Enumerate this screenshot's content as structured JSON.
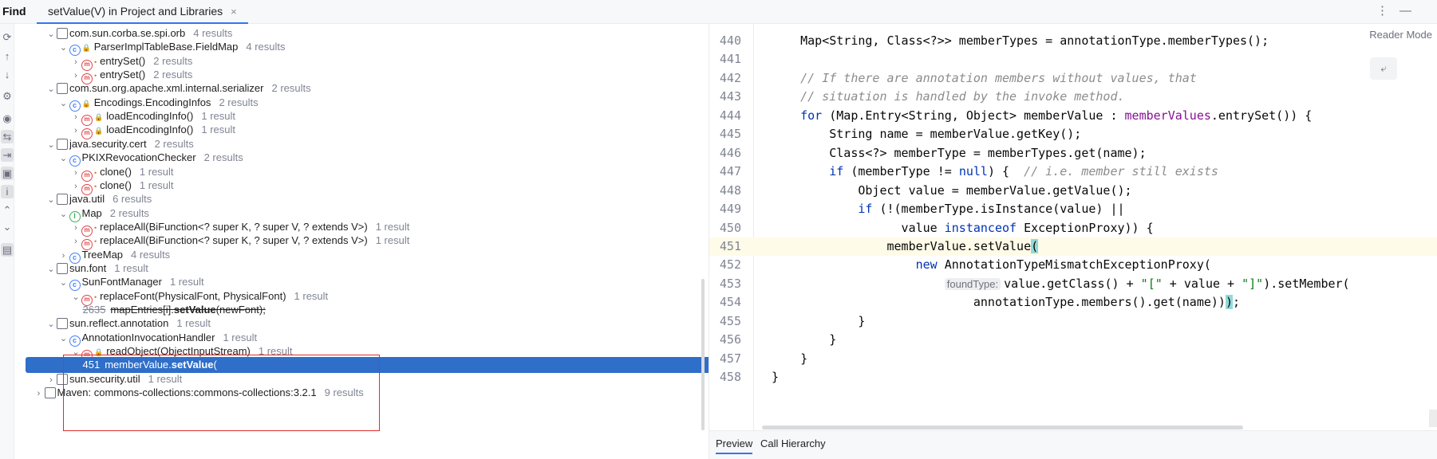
{
  "toolbar": {
    "title": "Find",
    "tab_label": "setValue(V) in Project and Libraries",
    "close_glyph": "×",
    "more_glyph": "⋮",
    "minimize_glyph": "—"
  },
  "tree": [
    {
      "depth": 2,
      "expanded": true,
      "kind": "package",
      "label": "com.sun.corba.se.spi.orb",
      "count": "4 results"
    },
    {
      "depth": 3,
      "expanded": true,
      "kind": "class",
      "label": "ParserImplTableBase.FieldMap",
      "count": "4 results",
      "locked": true
    },
    {
      "depth": 4,
      "expanded": false,
      "kind": "method",
      "label": "entrySet()",
      "count": "2 results",
      "dot": true
    },
    {
      "depth": 4,
      "expanded": false,
      "kind": "method",
      "label": "entrySet()",
      "count": "2 results",
      "dot": true
    },
    {
      "depth": 2,
      "expanded": true,
      "kind": "package",
      "label": "com.sun.org.apache.xml.internal.serializer",
      "count": "2 results"
    },
    {
      "depth": 3,
      "expanded": true,
      "kind": "class",
      "label": "Encodings.EncodingInfos",
      "count": "2 results",
      "locked": true
    },
    {
      "depth": 4,
      "expanded": false,
      "kind": "method",
      "label": "loadEncodingInfo()",
      "count": "1 result",
      "locked": true
    },
    {
      "depth": 4,
      "expanded": false,
      "kind": "method",
      "label": "loadEncodingInfo()",
      "count": "1 result",
      "locked": true
    },
    {
      "depth": 2,
      "expanded": true,
      "kind": "package",
      "label": "java.security.cert",
      "count": "2 results"
    },
    {
      "depth": 3,
      "expanded": true,
      "kind": "class",
      "label": "PKIXRevocationChecker",
      "count": "2 results"
    },
    {
      "depth": 4,
      "expanded": false,
      "kind": "method",
      "label": "clone()",
      "count": "1 result",
      "dot": true
    },
    {
      "depth": 4,
      "expanded": false,
      "kind": "method",
      "label": "clone()",
      "count": "1 result",
      "dot": true
    },
    {
      "depth": 2,
      "expanded": true,
      "kind": "package",
      "label": "java.util",
      "count": "6 results"
    },
    {
      "depth": 3,
      "expanded": true,
      "kind": "interface",
      "label": "Map",
      "count": "2 results"
    },
    {
      "depth": 4,
      "expanded": false,
      "kind": "method",
      "label": "replaceAll(BiFunction<? super K, ? super V, ? extends V>)",
      "count": "1 result",
      "dot": true
    },
    {
      "depth": 4,
      "expanded": false,
      "kind": "method",
      "label": "replaceAll(BiFunction<? super K, ? super V, ? extends V>)",
      "count": "1 result",
      "dot": true
    },
    {
      "depth": 3,
      "expanded": false,
      "kind": "class",
      "label": "TreeMap",
      "count": "4 results"
    },
    {
      "depth": 2,
      "expanded": true,
      "kind": "package",
      "label": "sun.font",
      "count": "1 result"
    },
    {
      "depth": 3,
      "expanded": true,
      "kind": "class",
      "label": "SunFontManager",
      "count": "1 result"
    },
    {
      "depth": 4,
      "expanded": true,
      "kind": "method",
      "label": "replaceFont(PhysicalFont, PhysicalFont)",
      "count": "1 result",
      "dot": true
    },
    {
      "depth": 5,
      "kind": "usage",
      "line": "2635",
      "pre": "mapEntries[i].",
      "bold": "setValue",
      "post": "(newFont);",
      "strike": true
    },
    {
      "depth": 2,
      "expanded": true,
      "kind": "package",
      "label": "sun.reflect.annotation",
      "count": "1 result"
    },
    {
      "depth": 3,
      "expanded": true,
      "kind": "class",
      "label": "AnnotationInvocationHandler",
      "count": "1 result"
    },
    {
      "depth": 4,
      "expanded": true,
      "kind": "method",
      "label": "readObject(ObjectInputStream)",
      "count": "1 result",
      "locked": true
    },
    {
      "depth": 5,
      "kind": "usage",
      "line": "451",
      "pre": "memberValue.",
      "bold": "setValue",
      "post": "(",
      "selected": true
    },
    {
      "depth": 2,
      "expanded": false,
      "kind": "package",
      "label": "sun.security.util",
      "count": "1 result",
      "strike": true
    },
    {
      "depth": 1,
      "expanded": false,
      "kind": "maven",
      "label": "Maven: commons-collections:commons-collections:3.2.1",
      "count": "9 results"
    }
  ],
  "editor": {
    "reader_mode": "Reader Mode",
    "current_line": "451",
    "lines": [
      {
        "n": "440",
        "html": "    Map&lt;String, Class&lt;?&gt;&gt; memberTypes = annotationType.memberTypes();"
      },
      {
        "n": "441",
        "html": ""
      },
      {
        "n": "442",
        "html": "    <span class='cm'>// If there are annotation members without values, that</span>"
      },
      {
        "n": "443",
        "html": "    <span class='cm'>// situation is handled by the invoke method.</span>"
      },
      {
        "n": "444",
        "html": "    <span class='kw'>for</span> (Map.Entry&lt;String, Object&gt; memberValue : <span class='fld'>memberValues</span>.entrySet()) {"
      },
      {
        "n": "445",
        "html": "        String name = memberValue.getKey();"
      },
      {
        "n": "446",
        "html": "        Class&lt;?&gt; memberType = memberTypes.get(name);"
      },
      {
        "n": "447",
        "html": "        <span class='kw'>if</span> (memberType != <span class='kw'>null</span>) {  <span class='cm'>// i.e. member still exists</span>"
      },
      {
        "n": "448",
        "html": "            Object value = memberValue.getValue();"
      },
      {
        "n": "449",
        "html": "            <span class='kw'>if</span> (!(memberType.isInstance(value) ||"
      },
      {
        "n": "450",
        "html": "                  value <span class='kw'>instanceof</span> ExceptionProxy)) {"
      },
      {
        "n": "451",
        "html": "                memberValue.setValue<span class='brace-hl'>(</span>"
      },
      {
        "n": "452",
        "html": "                    <span class='kw'>new</span> AnnotationTypeMismatchExceptionProxy("
      },
      {
        "n": "453",
        "html": "                        <span class='hint'>foundType:</span>value.getClass() + <span class='str'>\"[\"</span> + value + <span class='str'>\"]\"</span>).setMember("
      },
      {
        "n": "454",
        "html": "                            annotationType.members().get(name))<span class='brace-hl'>)</span>;"
      },
      {
        "n": "455",
        "html": "            }"
      },
      {
        "n": "456",
        "html": "        }"
      },
      {
        "n": "457",
        "html": "    }"
      },
      {
        "n": "458",
        "html": "}"
      }
    ]
  },
  "bottom": {
    "preview": "Preview",
    "call_hierarchy": "Call Hierarchy"
  }
}
